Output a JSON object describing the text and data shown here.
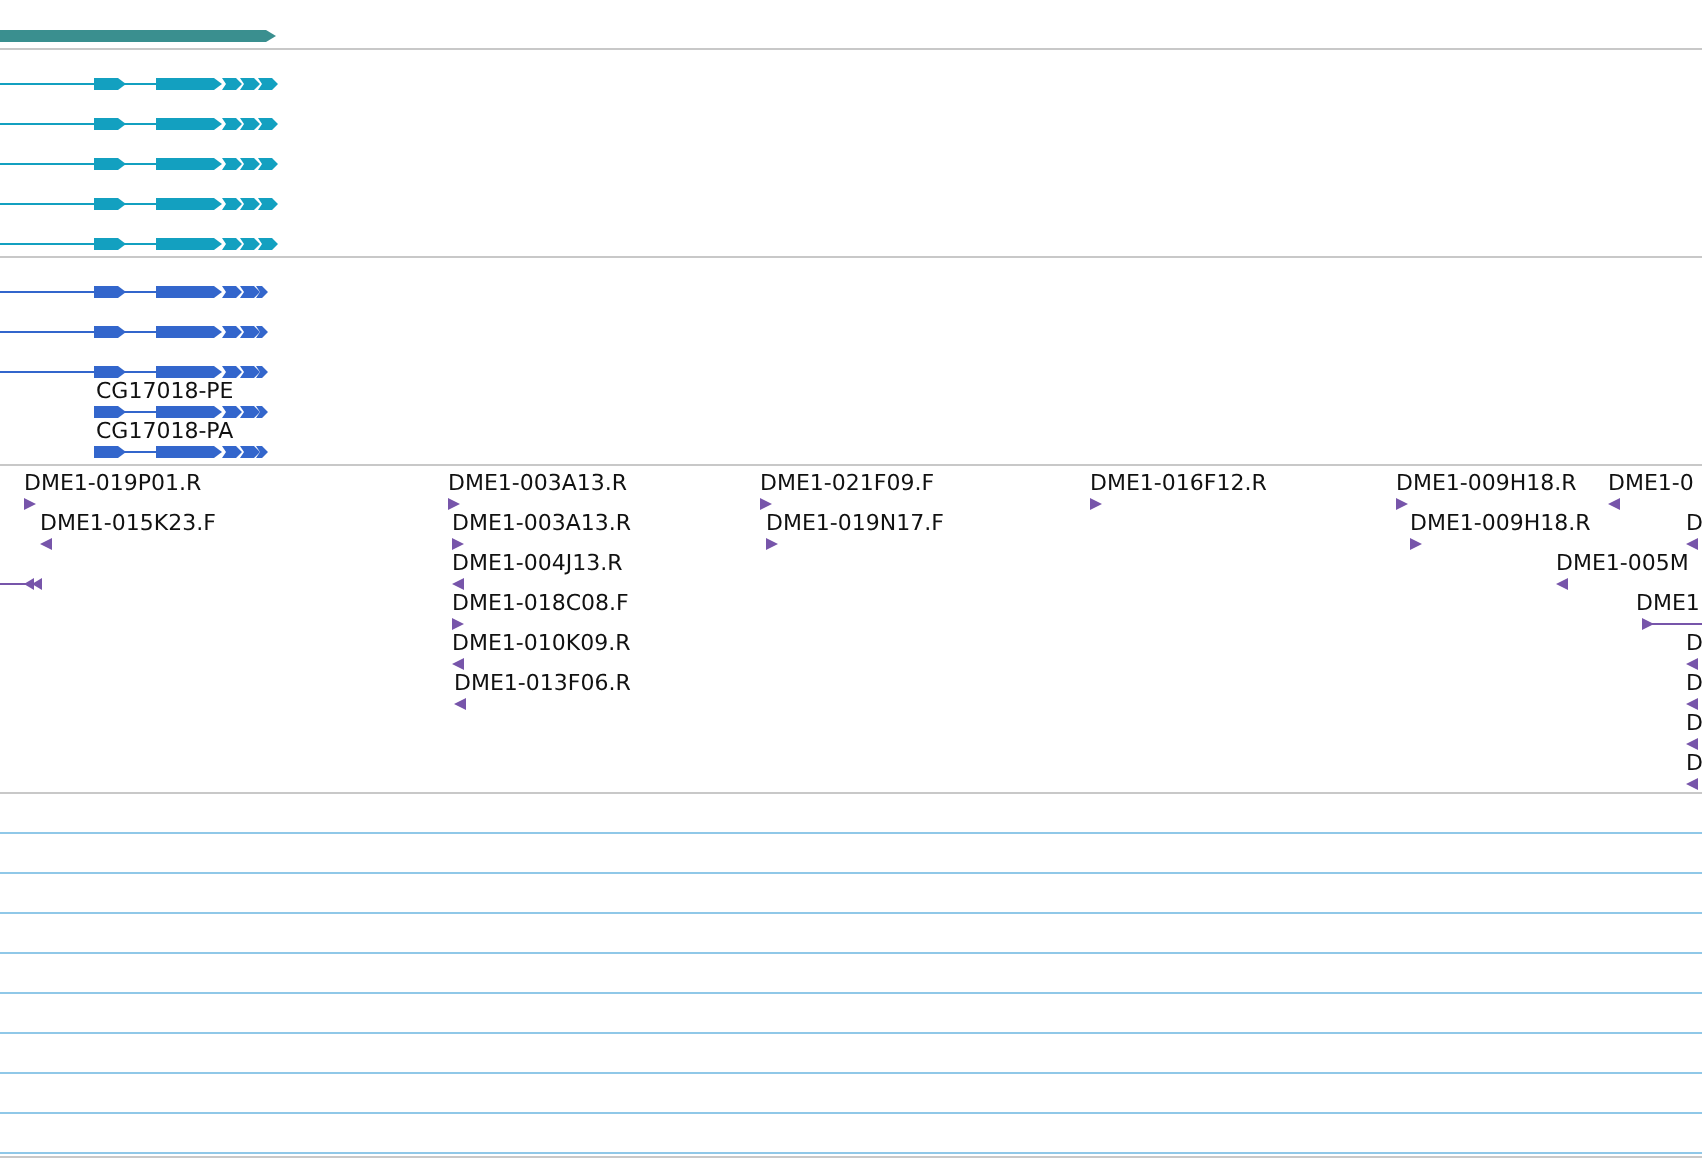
{
  "gene_track": {
    "reverse": false
  },
  "transcript_tracks": [
    {
      "color": "#13a0c0",
      "transcripts": [
        {
          "reverse": false
        },
        {
          "reverse": false
        },
        {
          "reverse": false
        },
        {
          "reverse": false
        },
        {
          "reverse": false
        }
      ]
    },
    {
      "color": "#3366cc",
      "transcripts": [
        {
          "reverse": false
        },
        {
          "reverse": false
        },
        {
          "reverse": false
        },
        {
          "label": "CG17018-PE",
          "reverse": false
        },
        {
          "label": "CG17018-PA",
          "reverse": false
        }
      ]
    }
  ],
  "est_track": {
    "features": [
      {
        "label": "DME1-019P01.R",
        "reverse": false
      },
      {
        "label": "DME1-015K23.F",
        "reverse": true
      },
      {
        "reverse": true
      },
      {
        "label": "DME1-003A13.R",
        "reverse": false
      },
      {
        "label": "DME1-003A13.R",
        "reverse": false
      },
      {
        "label": "DME1-004J13.R",
        "reverse": true
      },
      {
        "label": "DME1-018C08.F",
        "reverse": false
      },
      {
        "label": "DME1-010K09.R",
        "reverse": true
      },
      {
        "label": "DME1-013F06.R",
        "reverse": true
      },
      {
        "label": "DME1-021F09.F",
        "reverse": false
      },
      {
        "label": "DME1-019N17.F",
        "reverse": false
      },
      {
        "label": "DME1-016F12.R",
        "reverse": false
      },
      {
        "label": "DME1-009H18.R",
        "reverse": false
      },
      {
        "label": "DME1-0",
        "reverse": true
      },
      {
        "label": "DME1-009H18.R",
        "reverse": false
      },
      {
        "label": "D",
        "reverse": true
      },
      {
        "label": "DME1-005M",
        "reverse": true
      },
      {
        "label": "DME1",
        "reverse": false
      },
      {
        "label": "D",
        "reverse": true
      },
      {
        "label": "D",
        "reverse": true
      },
      {
        "label": "D",
        "reverse": true
      },
      {
        "label": "D",
        "reverse": true
      }
    ]
  }
}
